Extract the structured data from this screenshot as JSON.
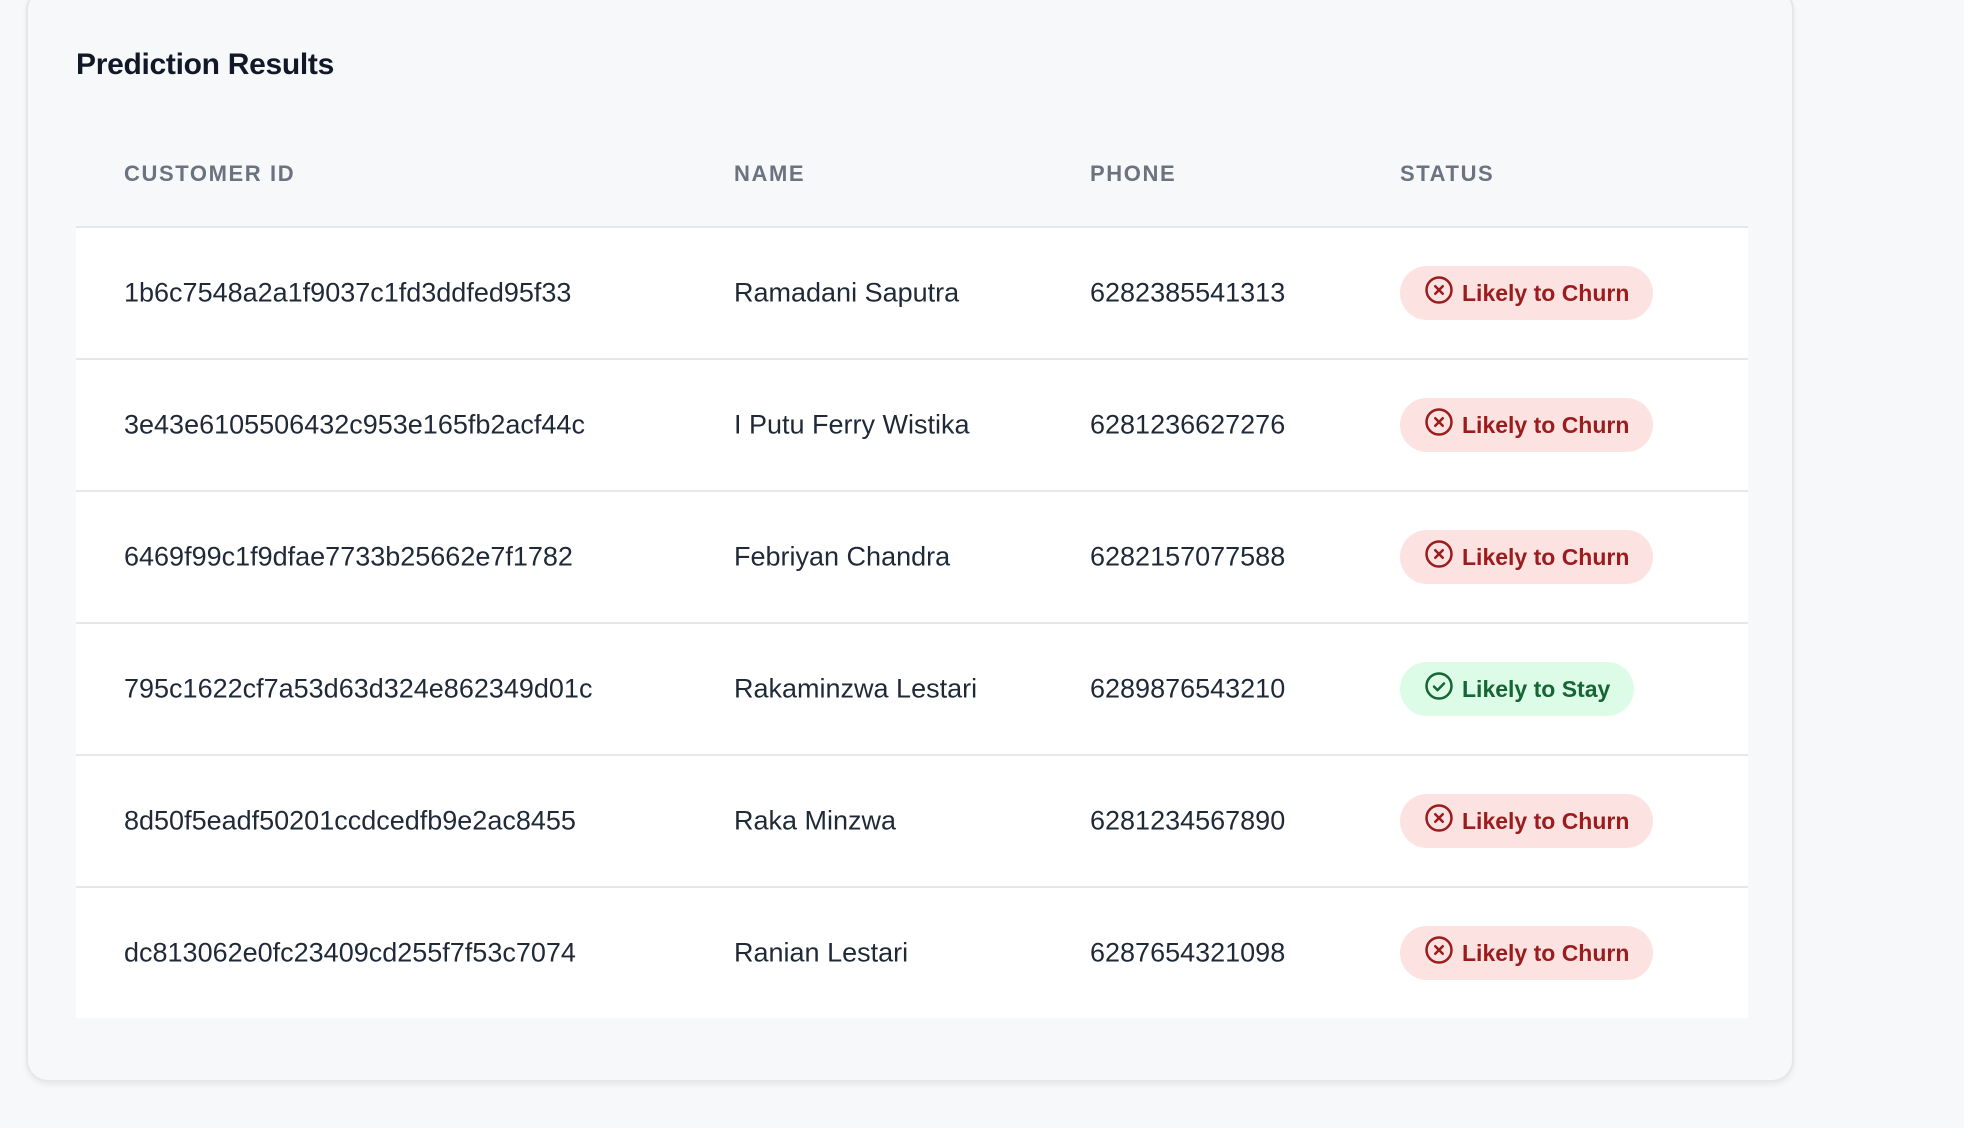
{
  "card": {
    "title": "Prediction Results"
  },
  "table": {
    "columns": [
      "CUSTOMER ID",
      "NAME",
      "PHONE",
      "STATUS"
    ],
    "rows": [
      {
        "customer_id": "1b6c7548a2a1f9037c1fd3ddfed95f33",
        "name": "Ramadani Saputra",
        "phone": "6282385541313",
        "status": "Likely to Churn",
        "status_type": "churn",
        "status_icon": "x-circle-icon"
      },
      {
        "customer_id": "3e43e6105506432c953e165fb2acf44c",
        "name": "I Putu Ferry Wistika",
        "phone": "6281236627276",
        "status": "Likely to Churn",
        "status_type": "churn",
        "status_icon": "x-circle-icon"
      },
      {
        "customer_id": "6469f99c1f9dfae7733b25662e7f1782",
        "name": "Febriyan Chandra",
        "phone": "6282157077588",
        "status": "Likely to Churn",
        "status_type": "churn",
        "status_icon": "x-circle-icon"
      },
      {
        "customer_id": "795c1622cf7a53d63d324e862349d01c",
        "name": "Rakaminzwa Lestari",
        "phone": "6289876543210",
        "status": "Likely to Stay",
        "status_type": "stay",
        "status_icon": "check-circle-icon"
      },
      {
        "customer_id": "8d50f5eadf50201ccdcedfb9e2ac8455",
        "name": "Raka Minzwa",
        "phone": "6281234567890",
        "status": "Likely to Churn",
        "status_type": "churn",
        "status_icon": "x-circle-icon"
      },
      {
        "customer_id": "dc813062e0fc23409cd255f7f53c7074",
        "name": "Ranian Lestari",
        "phone": "6287654321098",
        "status": "Likely to Churn",
        "status_type": "churn",
        "status_icon": "x-circle-icon"
      }
    ]
  },
  "colors": {
    "churn_bg": "#fde2e2",
    "churn_text": "#9b1c1c",
    "stay_bg": "#dcfce7",
    "stay_text": "#166534",
    "header_text": "#6b7280"
  }
}
